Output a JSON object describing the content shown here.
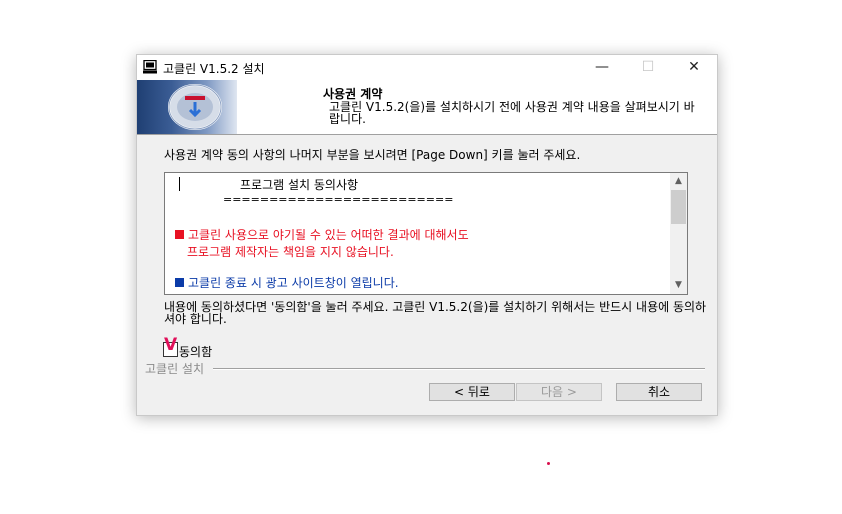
{
  "window": {
    "title": "고클린 V1.5.2 설치",
    "controls": {
      "minimize": "—",
      "maximize": "☐",
      "close": "✕"
    }
  },
  "header": {
    "title": "사용권 계약",
    "description": "고클린 V1.5.2(을)를 설치하시기 전에 사용권 계약 내용을 살펴보시기 바랍니다."
  },
  "instruction": "사용권 계약 동의 사항의 나머지 부분을 보시려면 [Page Down] 키를 눌러 주세요.",
  "license": {
    "heading": "프로그램 설치 동의사항",
    "divider": "=========================",
    "item1_line1": "고클린 사용으로 야기될 수 있는 어떠한 결과에 대해서도",
    "item1_line2": "프로그램 제작자는 책임을 지지 않습니다.",
    "item2": "고클린 종료 시 광고 사이트창이 열립니다."
  },
  "agree_text": "내용에 동의하셨다면 '동의함'을 눌러 주세요. 고클린 V1.5.2(을)를 설치하기 위해서는 반드시 내용에 동의하셔야 합니다.",
  "checkbox": {
    "label": "동의함",
    "checked": true
  },
  "brand_label": "고클린 설치",
  "buttons": {
    "back": "< 뒤로",
    "next": "다음 >",
    "cancel": "취소"
  },
  "colors": {
    "warning": "#e81123",
    "info": "#0b3ba8",
    "check": "#e0105a"
  },
  "icons": {
    "app": "installer-icon",
    "banner": "disc-icon"
  }
}
